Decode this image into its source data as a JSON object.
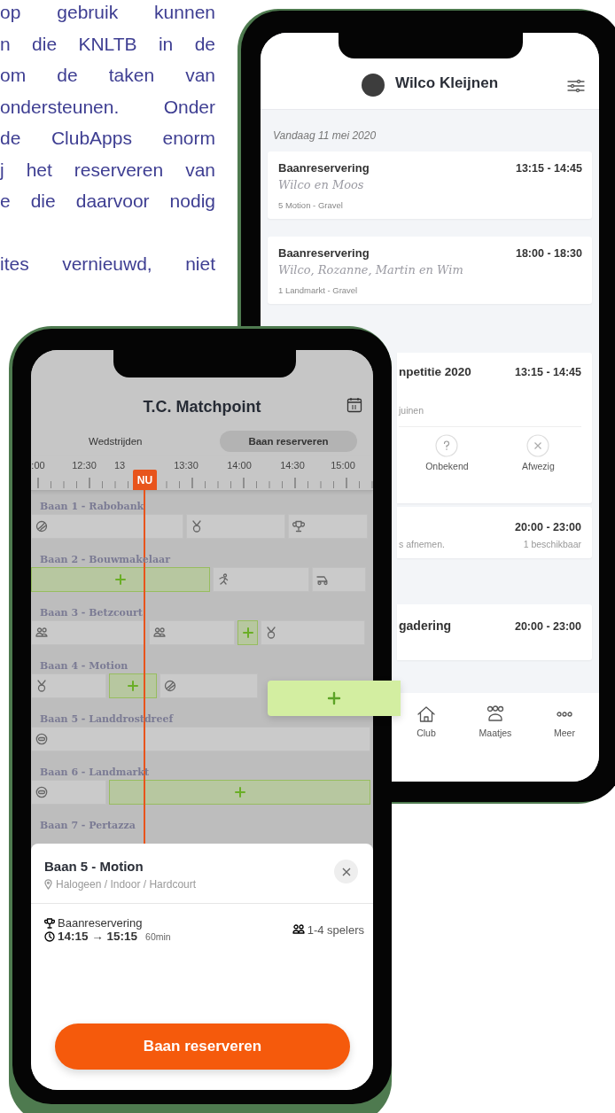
{
  "intro": {
    "paragraphs": [
      {
        "lines": [
          "op gebruik kunnen",
          "n die KNLTB in de",
          "om de taken van",
          "ondersteunen. Onder",
          "de ClubApps enorm",
          "j het reserveren van",
          "e die daarvoor nodig"
        ]
      },
      {
        "lines": [
          "ites vernieuwd, niet"
        ]
      }
    ]
  },
  "agenda_phone": {
    "header": {
      "title": "Wilco Kleijnen"
    },
    "date_heading": "Vandaag 11 mei 2020",
    "cards": [
      {
        "title": "Baanreservering",
        "time": "13:15 - 14:45",
        "players": "Wilco en Moos",
        "court": "5 Motion - Gravel"
      },
      {
        "title": "Baanreservering",
        "time": "18:00 - 18:30",
        "players": "Wilco, Rozanne, Martin en Wim",
        "court": "1 Landmarkt - Gravel"
      }
    ],
    "partial_cards": [
      {
        "kind": "match",
        "title": "npetitie 2020",
        "time": "13:15 - 14:45",
        "detail": "juinen",
        "responses": [
          {
            "label": "Onbekend",
            "kind": "unknown"
          },
          {
            "label": "Afwezig",
            "kind": "absent"
          }
        ]
      },
      {
        "kind": "shift",
        "time": "20:00 - 23:00",
        "detail": "s afnemen.",
        "availability": "1 beschikbaar"
      },
      {
        "kind": "meeting",
        "title": "gadering",
        "time": "20:00 - 23:00"
      }
    ],
    "nav": [
      {
        "label": "Club",
        "kind": "home"
      },
      {
        "label": "Maatjes",
        "kind": "buddies"
      },
      {
        "label": "Meer",
        "kind": "more"
      }
    ]
  },
  "booking_phone": {
    "header": {
      "title": "T.C. Matchpoint"
    },
    "tabs": [
      {
        "label": "Wedstrijden",
        "selected": false
      },
      {
        "label": "Baan reserveren",
        "selected": true
      }
    ],
    "timeline": {
      "ticks": [
        ":00",
        "12:30",
        "13",
        "13:30",
        "14:00",
        "14:30",
        "15:00"
      ],
      "now_label": "NU"
    },
    "courts": [
      {
        "name": "Baan 1 - Rabobank",
        "slots": [
          {
            "kind": "ball"
          },
          {
            "kind": "medal"
          },
          {
            "kind": "trophy"
          }
        ]
      },
      {
        "name": "Baan 2 - Bouwmakelaar",
        "slots": [
          {
            "kind": "free"
          },
          {
            "kind": "runner"
          },
          {
            "kind": "cart"
          }
        ]
      },
      {
        "name": "Baan 3 - Betzcourt",
        "slots": [
          {
            "kind": "people"
          },
          {
            "kind": "people"
          },
          {
            "kind": "free"
          },
          {
            "kind": "medal"
          }
        ]
      },
      {
        "name": "Baan 4 - Motion",
        "slots": [
          {
            "kind": "medal"
          },
          {
            "kind": "free"
          },
          {
            "kind": "ball"
          }
        ]
      },
      {
        "name": "Baan 5 - Landdrostdreef",
        "slots": [
          {
            "kind": "closed"
          }
        ]
      },
      {
        "name": "Baan 6 - Landmarkt",
        "slots": [
          {
            "kind": "closed"
          },
          {
            "kind": "free"
          }
        ]
      },
      {
        "name": "Baan 7 - Pertazza"
      }
    ],
    "sheet": {
      "title": "Baan 5 - Motion",
      "location": "Halogeen / Indoor / Hardcourt",
      "type": "Baanreservering",
      "players": "1-4 spelers",
      "time": "14:15 → 15:15",
      "duration": "60min",
      "button": "Baan reserveren"
    }
  }
}
